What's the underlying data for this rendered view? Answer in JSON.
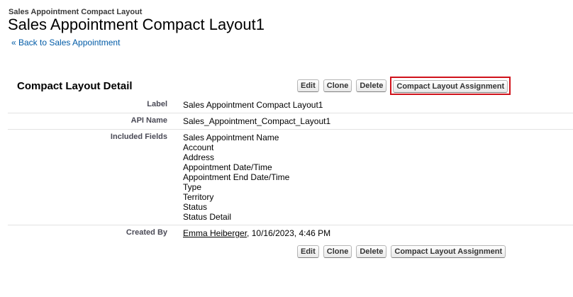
{
  "header": {
    "subtitle": "Sales Appointment Compact Layout",
    "title": "Sales Appointment Compact Layout1",
    "back_link": "« Back to Sales Appointment"
  },
  "section": {
    "title": "Compact Layout Detail"
  },
  "buttons": {
    "edit": "Edit",
    "clone": "Clone",
    "delete": "Delete",
    "assignment": "Compact Layout Assignment"
  },
  "details": {
    "label": {
      "name": "Label",
      "value": "Sales Appointment Compact Layout1"
    },
    "api_name": {
      "name": "API Name",
      "value": "Sales_Appointment_Compact_Layout1"
    },
    "included_fields": {
      "name": "Included Fields",
      "values": [
        "Sales Appointment Name",
        "Account",
        "Address",
        "Appointment Date/Time",
        "Appointment End Date/Time",
        "Type",
        "Territory",
        "Status",
        "Status Detail"
      ]
    },
    "created_by": {
      "name": "Created By",
      "user": "Emma Heiberger",
      "date": ", 10/16/2023, 4:46 PM"
    }
  },
  "colors": {
    "highlight": "#d0121b",
    "link": "#015ba7"
  }
}
